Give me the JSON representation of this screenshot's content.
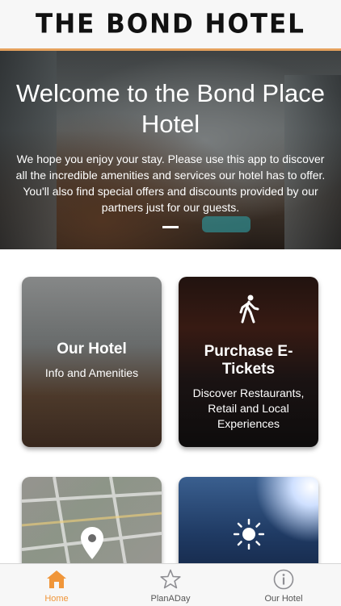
{
  "header": {
    "brand": "THE BOND HOTEL"
  },
  "hero": {
    "title": "Welcome to the Bond Place Hotel",
    "text": "We hope you enjoy your stay. Please use this app to discover all the incredible amenities and services our hotel has to offer. You'll also find special offers and discounts provided by our partners just for our guests."
  },
  "cards": {
    "hotel": {
      "title": "Our Hotel",
      "subtitle": "Info and Amenities"
    },
    "tickets": {
      "title": "Purchase E-Tickets",
      "subtitle": "Discover Restaurants, Retail and Local Experiences"
    }
  },
  "tabs": [
    {
      "label": "Home",
      "icon": "home-icon",
      "active": true
    },
    {
      "label": "PlanADay",
      "icon": "star-icon",
      "active": false
    },
    {
      "label": "Our Hotel",
      "icon": "info-icon",
      "active": false
    }
  ],
  "colors": {
    "accent": "#f0963a",
    "inactive_tab": "#8e8e93",
    "header_rule": "#e5a15d"
  }
}
